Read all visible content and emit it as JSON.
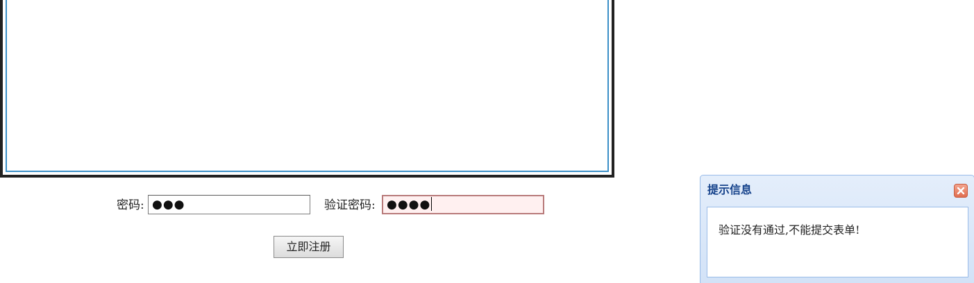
{
  "form": {
    "password_label": "密码:",
    "password_value": "●●●",
    "verify_label": "验证密码:",
    "verify_value": "●●●●",
    "submit_label": "立即注册"
  },
  "dialog": {
    "title": "提示信息",
    "message": "验证没有通过,不能提交表单!",
    "close_icon": "close-icon"
  },
  "colors": {
    "dialog_title": "#15428b",
    "dialog_border": "#99bbe8",
    "invalid_field_bg": "#fff0f0",
    "invalid_field_border": "#b87a7a",
    "close_button": "#e06d4f"
  }
}
